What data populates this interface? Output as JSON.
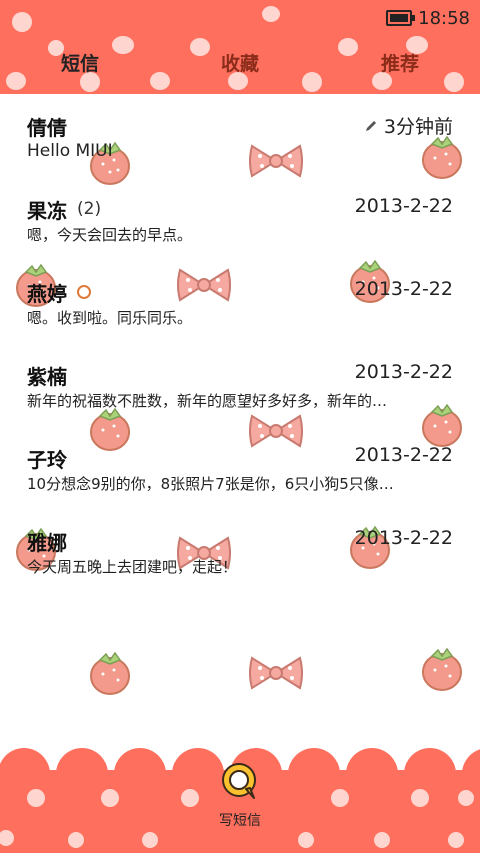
{
  "status_bar": {
    "time": "18:58",
    "battery_icon": "battery-icon"
  },
  "tabs": [
    {
      "label": "短信",
      "active": true
    },
    {
      "label": "收藏",
      "active": false
    },
    {
      "label": "推荐",
      "active": false
    }
  ],
  "threads": [
    {
      "name": "倩倩",
      "count": "",
      "unread": false,
      "time": "3分钟前",
      "edit_icon": "pencil-icon",
      "preview": "Hello MIUI"
    },
    {
      "name": "果冻",
      "count": "(2)",
      "unread": false,
      "time": "2013-2-22",
      "preview": "嗯，今天会回去的早点。"
    },
    {
      "name": "燕婷",
      "count": "",
      "unread": true,
      "time": "2013-2-22",
      "preview": "嗯。收到啦。同乐同乐。"
    },
    {
      "name": "紫楠",
      "count": "",
      "unread": false,
      "time": "2013-2-22",
      "preview": "新年的祝福数不胜数，新年的愿望好多好多，新年的…"
    },
    {
      "name": "子玲",
      "count": "",
      "unread": false,
      "time": "2013-2-22",
      "preview": "10分想念9别的你，8张照片7张是你，6只小狗5只像…"
    },
    {
      "name": "雅娜",
      "count": "",
      "unread": false,
      "time": "2013-2-22",
      "preview": "今天周五晚上去团建吧，走起！"
    }
  ],
  "compose": {
    "label": "写短信",
    "icon": "compose-message-icon"
  },
  "colors": {
    "theme": "#ff6f5e",
    "dot": "#ffd6cf",
    "strawberry": "#f39a8c",
    "bow": "#f6a9a0"
  }
}
